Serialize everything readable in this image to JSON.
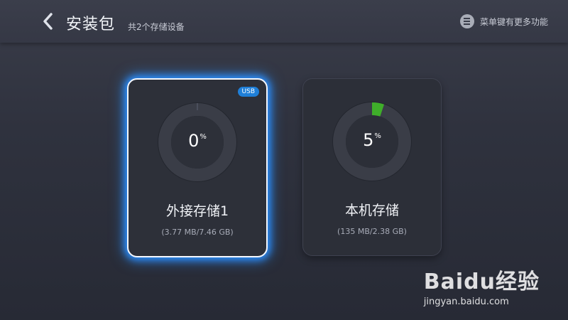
{
  "header": {
    "back_icon": "chevron-left-icon",
    "title": "安装包",
    "subtitle": "共2个存储设备",
    "menu_icon": "menu-icon",
    "menu_hint": "菜单键有更多功能"
  },
  "cards": [
    {
      "name": "外接存储1",
      "badge": "USB",
      "percent": "0",
      "percent_unit": "%",
      "usage_fraction": 0.0,
      "size": "(3.77 MB/7.46 GB)",
      "selected": true
    },
    {
      "name": "本机存储",
      "percent": "5",
      "percent_unit": "%",
      "usage_fraction": 0.05,
      "size": "(135 MB/2.38 GB)",
      "selected": false
    }
  ],
  "colors": {
    "accent_glow": "#2b8fff",
    "usage_arc": "#3fae2a",
    "badge": "#1f7fd8"
  },
  "watermark": {
    "logo": "Baidu经验",
    "url": "jingyan.baidu.com"
  }
}
